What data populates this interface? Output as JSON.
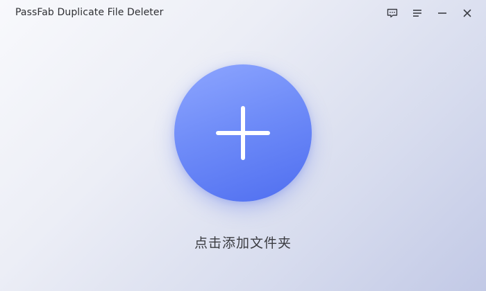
{
  "window": {
    "title": "PassFab Duplicate File Deleter",
    "controls": [
      {
        "name": "feedback-icon"
      },
      {
        "name": "menu-icon"
      },
      {
        "name": "minimize-icon"
      },
      {
        "name": "close-icon"
      }
    ]
  },
  "main": {
    "add_button_icon": "plus-icon",
    "add_label": "点击添加文件夹"
  },
  "colors": {
    "accent_top": "#8ea6ff",
    "accent_bottom": "#4f6ef0",
    "title_text": "#2e2f33"
  }
}
